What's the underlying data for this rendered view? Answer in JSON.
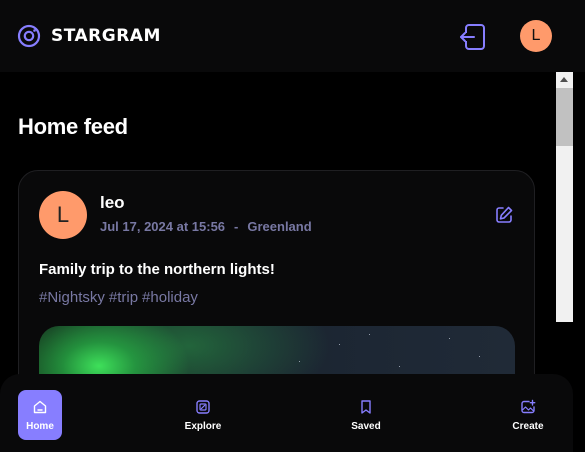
{
  "app": {
    "name": "STARGRAM"
  },
  "user": {
    "initial": "L"
  },
  "page": {
    "title": "Home feed"
  },
  "post": {
    "author": "leo",
    "author_initial": "L",
    "timestamp": "Jul 17, 2024 at 15:56",
    "separator": "-",
    "location": "Greenland",
    "caption": "Family trip to the northern lights!",
    "tags": [
      "#Nightsky",
      "#trip",
      "#holiday"
    ]
  },
  "nav": {
    "items": [
      {
        "label": "Home",
        "icon": "home-icon",
        "active": true
      },
      {
        "label": "Explore",
        "icon": "explore-icon",
        "active": false
      },
      {
        "label": "Saved",
        "icon": "bookmark-icon",
        "active": false
      },
      {
        "label": "Create",
        "icon": "create-image-icon",
        "active": false
      }
    ]
  },
  "colors": {
    "accent": "#877eff",
    "meta": "#7878a3",
    "avatar": "#ff9a6b",
    "surface": "#09090a"
  }
}
